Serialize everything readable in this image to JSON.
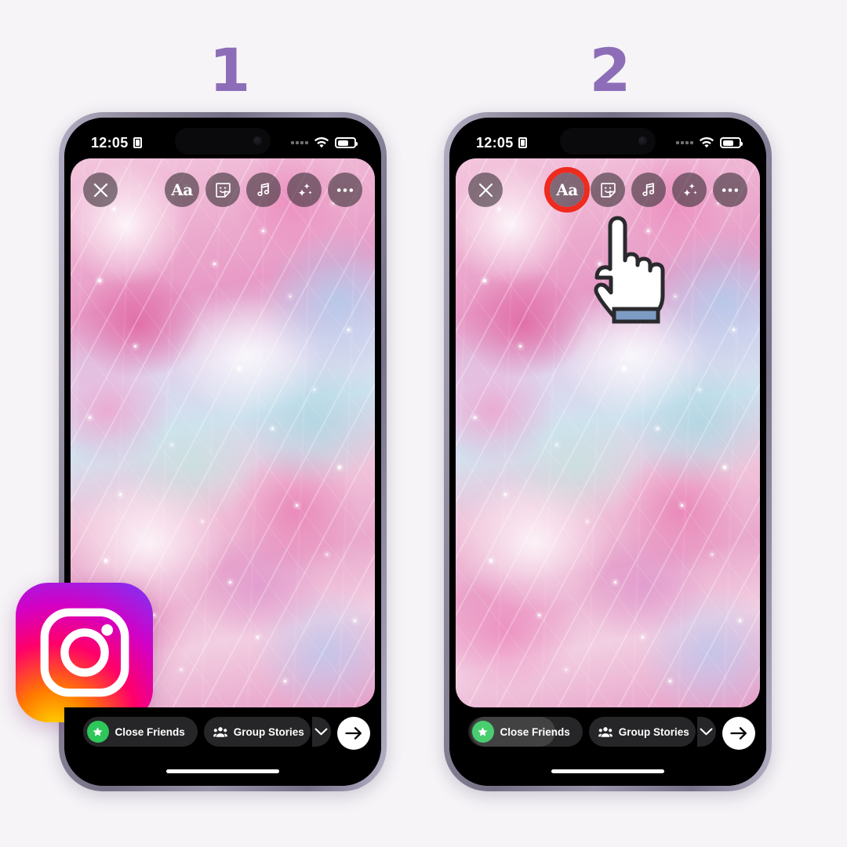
{
  "background_color": "#f6f4f7",
  "accent_color": "#8d6db8",
  "highlight_color": "#ef2a1e",
  "steps": [
    {
      "number": "1",
      "name": "step-one"
    },
    {
      "number": "2",
      "name": "step-two"
    }
  ],
  "status_bar": {
    "time": "12:05",
    "lock_icon": "sim-card-icon",
    "signal_icon": "signal-dots-icon",
    "wifi_icon": "wifi-icon",
    "battery_icon": "battery-icon"
  },
  "story_toolbar": {
    "close_label": "×",
    "buttons": [
      {
        "name": "text-tool-button",
        "icon": "text-aa-icon",
        "label": "Aa"
      },
      {
        "name": "sticker-tool-button",
        "icon": "sticker-smiley-icon",
        "label": ""
      },
      {
        "name": "music-tool-button",
        "icon": "music-note-icon",
        "label": ""
      },
      {
        "name": "effects-tool-button",
        "icon": "sparkles-icon",
        "label": ""
      },
      {
        "name": "more-options-button",
        "icon": "ellipsis-icon",
        "label": ""
      }
    ]
  },
  "bottom_bar": {
    "close_friends_label": "Close Friends",
    "close_friends_label_partial": "Friends",
    "group_stories_label": "Group Stories",
    "star_icon": "star-icon",
    "group_icon": "group-people-icon",
    "chevron_icon": "chevron-down-icon",
    "send_icon": "arrow-right-icon"
  },
  "brand": {
    "logo_name": "instagram-logo",
    "gradient": [
      "#ffd600",
      "#ff7a00",
      "#ff0069",
      "#d300c5",
      "#7638fa"
    ]
  },
  "cursor": {
    "name": "pointing-hand-cursor",
    "target": "text-tool-button"
  }
}
